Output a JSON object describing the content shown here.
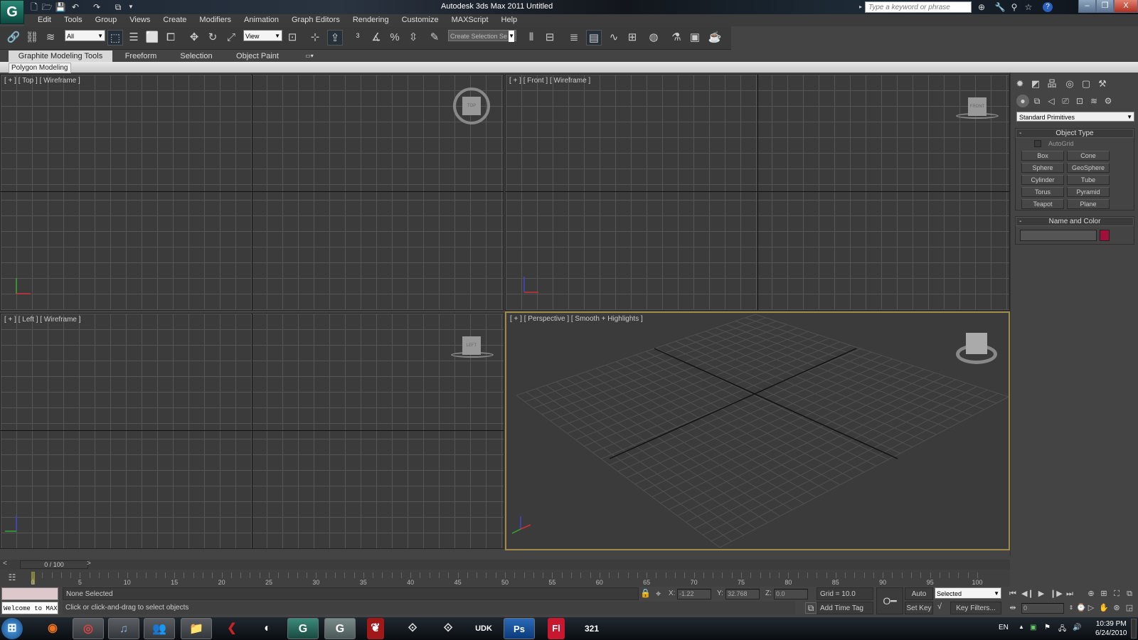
{
  "titlebar": {
    "app_title": "Autodesk 3ds Max  2011",
    "document": "Untitled",
    "search_placeholder": "Type a keyword or phrase",
    "quick_access": [
      "new-file-icon",
      "open-file-icon",
      "save-icon",
      "undo-icon",
      "redo-icon",
      "project-folder-icon"
    ],
    "info_icons": [
      "binoculars-icon",
      "key-icon",
      "satellite-icon",
      "star-icon",
      "help-icon"
    ],
    "window_buttons": {
      "minimize": "–",
      "restore": "❐",
      "close": "X"
    }
  },
  "menu": [
    "Edit",
    "Tools",
    "Group",
    "Views",
    "Create",
    "Modifiers",
    "Animation",
    "Graph Editors",
    "Rendering",
    "Customize",
    "MAXScript",
    "Help"
  ],
  "toolbar": {
    "selection_filter": "All",
    "ref_coord": "View",
    "named_selection": "Create Selection Se"
  },
  "ribbon": {
    "tabs": [
      "Graphite Modeling Tools",
      "Freeform",
      "Selection",
      "Object Paint"
    ],
    "active_tab": 0,
    "panel_label": "Polygon Modeling"
  },
  "viewports": [
    {
      "label": "[ + ] [ Top ] [ Wireframe ]",
      "viewcube": "TOP"
    },
    {
      "label": "[ + ] [ Front ] [ Wireframe ]",
      "viewcube": "FRONT"
    },
    {
      "label": "[ + ] [ Left ] [ Wireframe ]",
      "viewcube": "LEFT"
    },
    {
      "label": "[ + ] [ Perspective ] [ Smooth + Highlights ]",
      "viewcube": ""
    }
  ],
  "command_panel": {
    "category": "Standard Primitives",
    "object_type_title": "Object Type",
    "autogrid_label": "AutoGrid",
    "autogrid_checked": false,
    "buttons": [
      "Box",
      "Cone",
      "Sphere",
      "GeoSphere",
      "Cylinder",
      "Tube",
      "Torus",
      "Pyramid",
      "Teapot",
      "Plane"
    ],
    "name_color_title": "Name and Color",
    "name_value": "",
    "object_color": "#a0103a"
  },
  "timeline": {
    "slider_text": "0 / 100",
    "prev": "<",
    "next": ">",
    "ticks": [
      "0",
      "5",
      "10",
      "15",
      "20",
      "25",
      "30",
      "35",
      "40",
      "45",
      "50",
      "55",
      "60",
      "65",
      "70",
      "75",
      "80",
      "85",
      "90",
      "95",
      "100"
    ]
  },
  "status": {
    "maxscript_listener": "Welcome to MAXS",
    "selection": "None Selected",
    "prompt": "Click or click-and-drag to select objects",
    "x_label": "X:",
    "x": "-1.22",
    "y_label": "Y:",
    "y": "32.768",
    "z_label": "Z:",
    "z": "0.0",
    "grid": "Grid = 10.0",
    "add_time_tag": "Add Time Tag",
    "auto_key": "Auto Key",
    "set_key": "Set Key",
    "key_mode": "Selected",
    "key_filters": "Key Filters...",
    "current_frame": "0"
  },
  "taskbar": {
    "apps": [
      "start",
      "firefox",
      "chrome",
      "itunes",
      "messenger",
      "explorer",
      "cubase",
      "inkscape",
      "3dsmax",
      "3dsmax",
      "autodesk",
      "unity",
      "unity",
      "udk",
      "photoshop",
      "flash",
      "mediaplayer"
    ],
    "lang": "EN",
    "time": "10:39 PM",
    "date": "6/24/2010"
  }
}
